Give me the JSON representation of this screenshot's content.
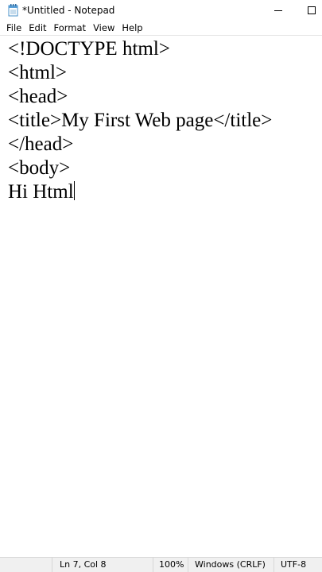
{
  "window": {
    "title": "*Untitled - Notepad",
    "app_icon": "notepad-icon",
    "controls": {
      "minimize_icon": "minimize-icon",
      "maximize_icon": "maximize-icon"
    }
  },
  "menubar": {
    "items": [
      "File",
      "Edit",
      "Format",
      "View",
      "Help"
    ]
  },
  "editor": {
    "lines": [
      "<!DOCTYPE html>",
      "<html>",
      "<head>",
      "<title>My First Web page</title>",
      "</head>",
      "<body>",
      "Hi Html"
    ]
  },
  "statusbar": {
    "position": "Ln 7, Col 8",
    "zoom": "100%",
    "line_endings": "Windows (CRLF)",
    "encoding": "UTF-8"
  }
}
